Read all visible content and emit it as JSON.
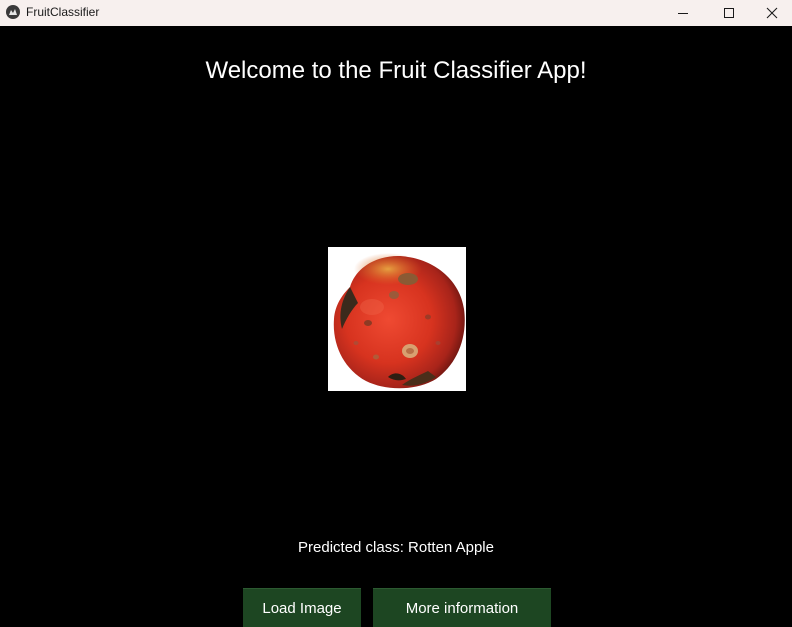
{
  "window": {
    "title": "FruitClassifier",
    "app_icon": "kivy-logo-icon",
    "controls": {
      "minimize_icon": "minimize-icon",
      "maximize_icon": "maximize-icon",
      "close_icon": "close-icon"
    }
  },
  "main": {
    "heading": "Welcome to the Fruit Classifier App!",
    "image": {
      "subject": "rotten apple photo"
    },
    "prediction": "Predicted class: Rotten Apple"
  },
  "buttons": {
    "load_image": "Load Image",
    "more_information": "More information"
  },
  "colors": {
    "background": "#000000",
    "titlebar": "#f7f0ee",
    "button": "#1d4622",
    "text": "#ffffff"
  }
}
